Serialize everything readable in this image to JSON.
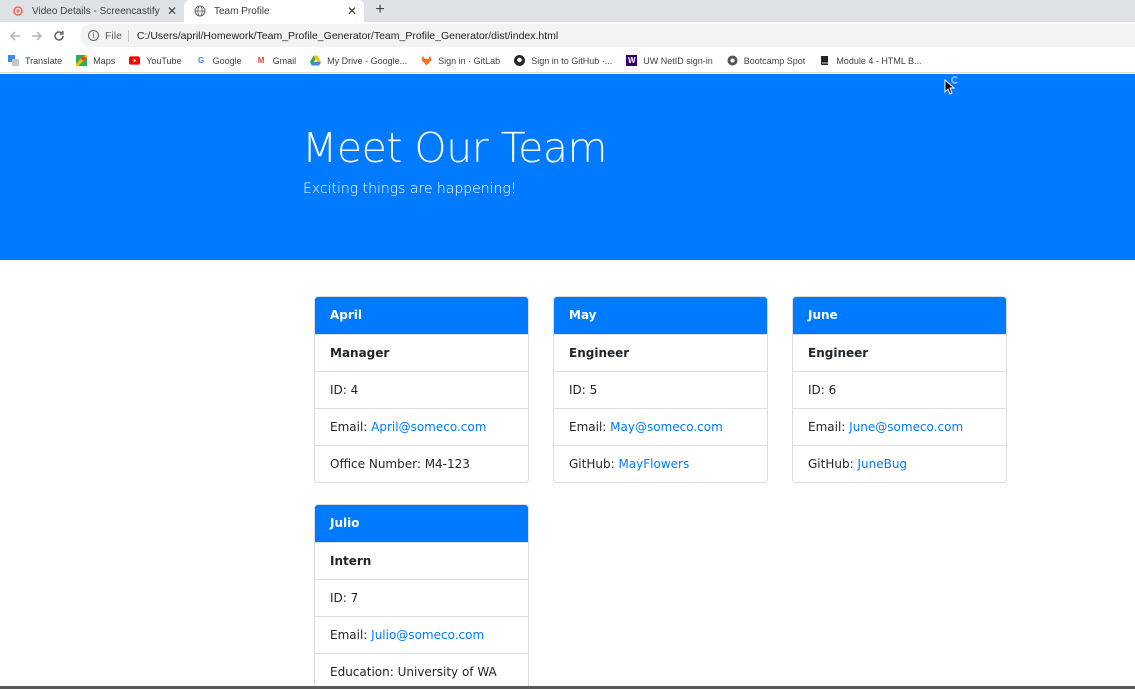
{
  "browser": {
    "tabs": [
      {
        "title": "Video Details - Screencastify",
        "active": false
      },
      {
        "title": "Team Profile",
        "active": true
      }
    ],
    "address": {
      "scheme": "File",
      "url": "C:/Users/april/Homework/Team_Profile_Generator/Team_Profile_Generator/dist/index.html"
    },
    "bookmarks": [
      {
        "label": "Translate",
        "icon": "translate-icon"
      },
      {
        "label": "Maps",
        "icon": "maps-icon"
      },
      {
        "label": "YouTube",
        "icon": "youtube-icon"
      },
      {
        "label": "Google",
        "icon": "google-icon"
      },
      {
        "label": "Gmail",
        "icon": "gmail-icon"
      },
      {
        "label": "My Drive - Google...",
        "icon": "drive-icon"
      },
      {
        "label": "Sign in · GitLab",
        "icon": "gitlab-icon"
      },
      {
        "label": "Sign in to GitHub ·...",
        "icon": "github-icon"
      },
      {
        "label": "UW NetID sign-in",
        "icon": "uw-icon"
      },
      {
        "label": "Bootcamp Spot",
        "icon": "bootcamp-icon"
      },
      {
        "label": "Module 4 - HTML B...",
        "icon": "book-icon"
      }
    ],
    "colors": {
      "accent": "#007bff",
      "tabstrip": "#dee1e6"
    }
  },
  "page": {
    "title": "Meet Our Team",
    "subtitle": "Exciting things are happening!",
    "cards": [
      {
        "name": "April",
        "role": "Manager",
        "id": "ID: 4",
        "email_label": "Email: ",
        "email": "April@someco.com",
        "extra_label": "Office Number: M4-123",
        "extra_link": ""
      },
      {
        "name": "May",
        "role": "Engineer",
        "id": "ID: 5",
        "email_label": "Email: ",
        "email": "May@someco.com",
        "extra_label": "GitHub: ",
        "extra_link": "MayFlowers"
      },
      {
        "name": "June",
        "role": "Engineer",
        "id": "ID: 6",
        "email_label": "Email: ",
        "email": "June@someco.com",
        "extra_label": "GitHub: ",
        "extra_link": "JuneBug"
      },
      {
        "name": "Julio",
        "role": "Intern",
        "id": "ID: 7",
        "email_label": "Email: ",
        "email": "Julio@someco.com",
        "extra_label": "Education: University of WA",
        "extra_link": ""
      }
    ]
  }
}
